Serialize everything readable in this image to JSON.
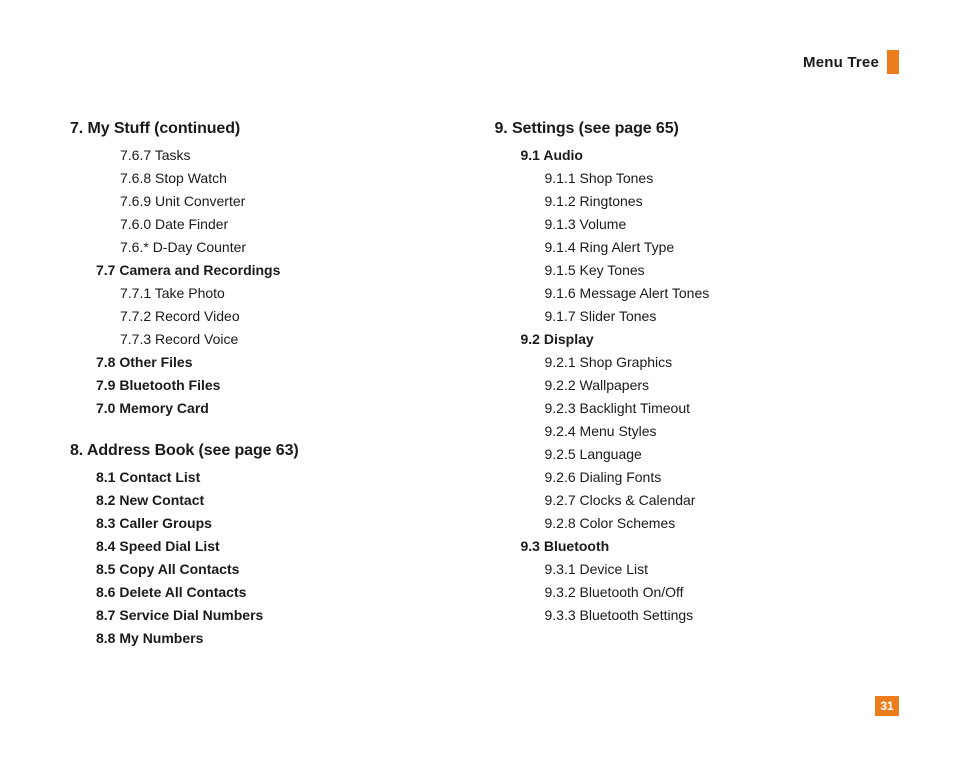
{
  "header": {
    "title": "Menu Tree"
  },
  "page_number": "31",
  "left": {
    "section7": {
      "title": "7.  My Stuff (continued)",
      "items_a": [
        "7.6.7 Tasks",
        "7.6.8 Stop Watch",
        "7.6.9 Unit Converter",
        "7.6.0 Date Finder",
        "7.6.* D-Day Counter"
      ],
      "sub77": "7.7 Camera and Recordings",
      "items_b": [
        "7.7.1 Take Photo",
        "7.7.2 Record Video",
        "7.7.3 Record Voice"
      ],
      "subs_tail": [
        "7.8 Other Files",
        "7.9 Bluetooth Files",
        "7.0 Memory Card"
      ]
    },
    "section8": {
      "title": "8.  Address Book (see page 63)",
      "subs": [
        "8.1 Contact List",
        "8.2 New Contact",
        "8.3 Caller Groups",
        "8.4 Speed Dial List",
        "8.5 Copy All Contacts",
        "8.6 Delete All Contacts",
        "8.7 Service Dial Numbers",
        "8.8 My Numbers"
      ]
    }
  },
  "right": {
    "section9": {
      "title": "9.  Settings (see page 65)",
      "sub91": "9.1 Audio",
      "items91": [
        "9.1.1 Shop Tones",
        "9.1.2 Ringtones",
        "9.1.3 Volume",
        "9.1.4 Ring Alert Type",
        "9.1.5 Key Tones",
        "9.1.6 Message Alert Tones",
        "9.1.7 Slider Tones"
      ],
      "sub92": "9.2 Display",
      "items92": [
        "9.2.1 Shop Graphics",
        "9.2.2 Wallpapers",
        "9.2.3 Backlight Timeout",
        "9.2.4 Menu Styles",
        "9.2.5 Language",
        "9.2.6 Dialing Fonts",
        "9.2.7 Clocks & Calendar",
        "9.2.8 Color Schemes"
      ],
      "sub93": "9.3 Bluetooth",
      "items93": [
        "9.3.1 Device List",
        "9.3.2 Bluetooth On/Off",
        "9.3.3 Bluetooth Settings"
      ]
    }
  }
}
